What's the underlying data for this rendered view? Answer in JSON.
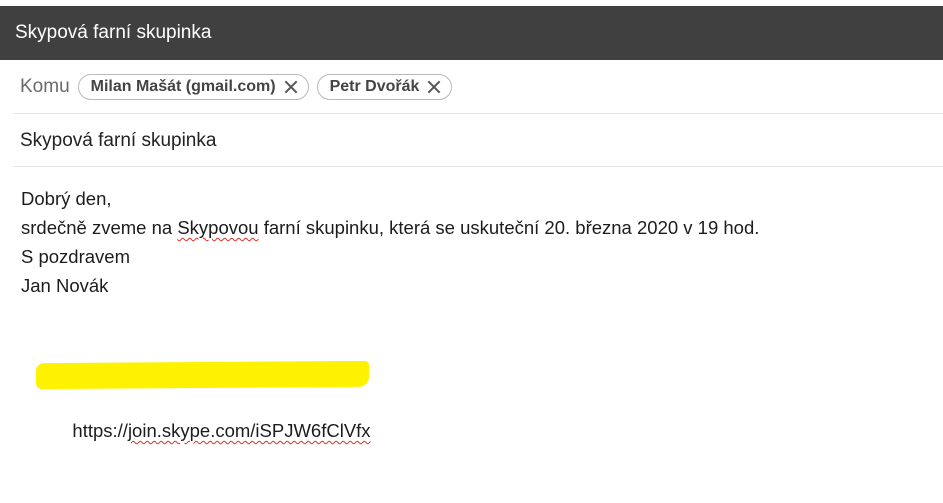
{
  "window": {
    "title": "Skypová farní skupinka"
  },
  "recipients": {
    "label": "Komu",
    "chips": [
      {
        "name": "Milan Mašát (gmail.com)"
      },
      {
        "name": "Petr Dvořák"
      }
    ]
  },
  "subject": "Skypová farní skupinka",
  "message": {
    "greeting": "Dobrý den,",
    "line2_before": "srdečně zveme na ",
    "line2_misspelled": "Skypovou",
    "line2_after": " farní skupinku, která se uskuteční 20. března 2020 v 19 hod.",
    "closing": "S pozdravem",
    "signature": "Jan Novák",
    "link_prefix": "https://",
    "link_misspelled": "join.skype.com/iSPJW6fClVfx"
  },
  "colors": {
    "titlebar": "#404040",
    "highlight": "#fff200",
    "spellcheck": "#d93025"
  }
}
